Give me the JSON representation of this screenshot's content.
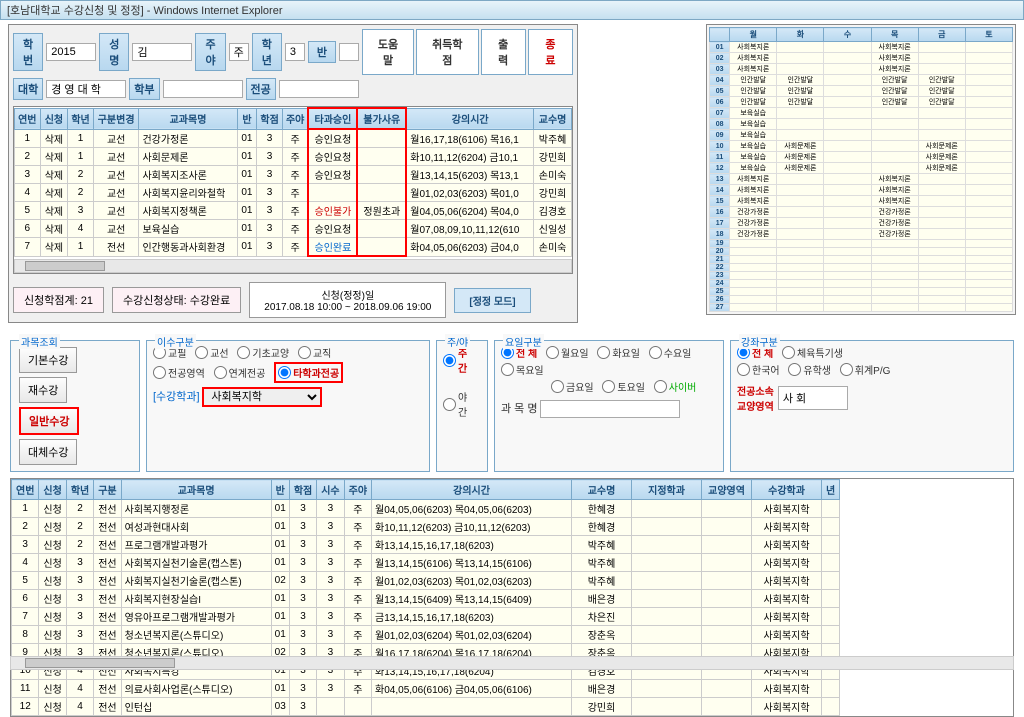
{
  "window_title": "[호남대학교 수강신청 및 정정] - Windows Internet Explorer",
  "form": {
    "hakbun_label": "학번",
    "hakbun": "2015",
    "name_label": "성명",
    "name": "김",
    "day_label": "주야",
    "day": "주",
    "grade_label": "학년",
    "grade": "3",
    "class_label": "반",
    "univ_label": "대학",
    "univ": "경 영 대 학",
    "dept_label": "학부",
    "major_label": "전공"
  },
  "toolbar": {
    "help": "도움말",
    "earned": "취득학점",
    "print": "출 력",
    "exit": "종 료"
  },
  "grid1_headers": {
    "no": "연번",
    "req": "신청",
    "yr": "학년",
    "cls": "구분변경",
    "course": "교과목명",
    "ban": "반",
    "cred": "학점",
    "dn": "주야",
    "appr": "타과승인",
    "reason": "불가사유",
    "time": "강의시간",
    "prof": "교수명"
  },
  "grid1": [
    {
      "no": "1",
      "req": "삭제",
      "yr": "1",
      "cls": "교선",
      "course": "건강가정론",
      "ban": "01",
      "cred": "3",
      "dn": "주",
      "appr": "승인요청",
      "reason": "",
      "time": "월16,17,18(6106) 목16,1",
      "prof": "박주혜"
    },
    {
      "no": "2",
      "req": "삭제",
      "yr": "1",
      "cls": "교선",
      "course": "사회문제론",
      "ban": "01",
      "cred": "3",
      "dn": "주",
      "appr": "승인요청",
      "reason": "",
      "time": "화10,11,12(6204) 금10,1",
      "prof": "강민희"
    },
    {
      "no": "3",
      "req": "삭제",
      "yr": "2",
      "cls": "교선",
      "course": "사회복지조사론",
      "ban": "01",
      "cred": "3",
      "dn": "주",
      "appr": "승인요청",
      "reason": "",
      "time": "월13,14,15(6203) 목13,1",
      "prof": "손미숙"
    },
    {
      "no": "4",
      "req": "삭제",
      "yr": "2",
      "cls": "교선",
      "course": "사회복지윤리와철학",
      "ban": "01",
      "cred": "3",
      "dn": "주",
      "appr": "",
      "reason": "",
      "time": "월01,02,03(6203) 목01,0",
      "prof": "강민희"
    },
    {
      "no": "5",
      "req": "삭제",
      "yr": "3",
      "cls": "교선",
      "course": "사회복지정책론",
      "ban": "01",
      "cred": "3",
      "dn": "주",
      "appr": "승인불가",
      "reason": "정원초과",
      "time": "월04,05,06(6204) 목04,0",
      "prof": "김경호"
    },
    {
      "no": "6",
      "req": "삭제",
      "yr": "4",
      "cls": "교선",
      "course": "보육실습",
      "ban": "01",
      "cred": "3",
      "dn": "주",
      "appr": "승인요청",
      "reason": "",
      "time": "월07,08,09,10,11,12(610",
      "prof": "신일성"
    },
    {
      "no": "7",
      "req": "삭제",
      "yr": "1",
      "cls": "전선",
      "course": "인간행동과사회환경",
      "ban": "01",
      "cred": "3",
      "dn": "주",
      "appr": "승인완료",
      "reason": "",
      "time": "화04,05,06(6203) 금04,0",
      "prof": "손미숙"
    }
  ],
  "status": {
    "credits": "신청학점계:  21",
    "state": "수강신청상태:  수강완료",
    "period_title": "신청(정정)일",
    "period": "2017.08.18 10:00 ~ 2018.09.06 19:00",
    "mode": "[정정 모드]"
  },
  "sched_days": {
    "mon": "월",
    "tue": "화",
    "wed": "수",
    "thu": "목",
    "fri": "금",
    "sat": "토"
  },
  "sched_rows": [
    {
      "no": "01",
      "mon": "사회복지론",
      "thu": "사회복지론"
    },
    {
      "no": "02",
      "mon": "사회복지론",
      "thu": "사회복지론"
    },
    {
      "no": "03",
      "mon": "사회복지론",
      "thu": "사회복지론"
    },
    {
      "no": "04",
      "mon": "인간발달",
      "tue": "인간발달",
      "thu": "인간발달",
      "fri": "인간발달"
    },
    {
      "no": "05",
      "mon": "인간발달",
      "tue": "인간발달",
      "thu": "인간발달",
      "fri": "인간발달"
    },
    {
      "no": "06",
      "mon": "인간발달",
      "tue": "인간발달",
      "thu": "인간발달",
      "fri": "인간발달"
    },
    {
      "no": "07",
      "mon": "보육실습"
    },
    {
      "no": "08",
      "mon": "보육실습"
    },
    {
      "no": "09",
      "mon": "보육실습"
    },
    {
      "no": "10",
      "mon": "보육실습",
      "tue": "사회문제론",
      "fri": "사회문제론"
    },
    {
      "no": "11",
      "mon": "보육실습",
      "tue": "사회문제론",
      "fri": "사회문제론"
    },
    {
      "no": "12",
      "mon": "보육실습",
      "tue": "사회문제론",
      "fri": "사회문제론"
    },
    {
      "no": "13",
      "mon": "사회복지론",
      "thu": "사회복지론"
    },
    {
      "no": "14",
      "mon": "사회복지론",
      "thu": "사회복지론"
    },
    {
      "no": "15",
      "mon": "사회복지론",
      "thu": "사회복지론"
    },
    {
      "no": "16",
      "mon": "건강가정론",
      "thu": "건강가정론"
    },
    {
      "no": "17",
      "mon": "건강가정론",
      "thu": "건강가정론"
    },
    {
      "no": "18",
      "mon": "건강가정론",
      "thu": "건강가정론"
    },
    {
      "no": "19"
    },
    {
      "no": "20"
    },
    {
      "no": "21"
    },
    {
      "no": "22"
    },
    {
      "no": "23"
    },
    {
      "no": "24"
    },
    {
      "no": "25"
    },
    {
      "no": "26"
    },
    {
      "no": "27"
    }
  ],
  "filters": {
    "lookup_title": "과목조회",
    "tab_basic": "기본수강",
    "tab_retake": "재수강",
    "tab_general": "일반수강",
    "tab_subst": "대체수강",
    "compl_title": "이수구분",
    "c_gyopil": "교필",
    "c_gyoseon": "교선",
    "c_gicho": "기초교양",
    "c_gyojik": "교직",
    "c_area": "전공영역",
    "c_link": "연계전공",
    "c_other": "타학과전공",
    "dayn_title": "주/야",
    "dn_day": "주간",
    "dn_night": "야간",
    "dow_title": "요일구분",
    "dw_all": "전 체",
    "dw_mon": "월요일",
    "dw_tue": "화요일",
    "dw_wed": "수요일",
    "dw_thu": "목요일",
    "dw_fri": "금요일",
    "dw_sat": "토요일",
    "dw_cyber": "사이버",
    "lect_title": "강좌구분",
    "lc_all": "전 체",
    "lc_pe": "체육특기생",
    "lc_kr": "한국어",
    "lc_intl": "유학생",
    "lc_pg": "휘계P/G",
    "sel_dept": "[수강학과]",
    "dept_val": "사회복지학",
    "subj_label": "과 목 명",
    "affil1": "전공소속",
    "affil2": "교양영역",
    "affil_val": "사 회"
  },
  "grid2_headers": {
    "no": "연번",
    "req": "신청",
    "yr": "학년",
    "cls": "구분",
    "course": "교과목명",
    "ban": "반",
    "cred": "학점",
    "hrs": "시수",
    "dn": "주야",
    "time": "강의시간",
    "prof": "교수명",
    "dept": "지정학과",
    "area": "교양영역",
    "host": "수강학과",
    "yrh": "년"
  },
  "grid2": [
    {
      "no": "1",
      "req": "신청",
      "yr": "2",
      "cls": "전선",
      "course": "사회복지행정론",
      "ban": "01",
      "cred": "3",
      "hrs": "3",
      "dn": "주",
      "time": "월04,05,06(6203) 목04,05,06(6203)",
      "prof": "한혜경",
      "host": "사회복지학"
    },
    {
      "no": "2",
      "req": "신청",
      "yr": "2",
      "cls": "전선",
      "course": "여성과현대사회",
      "ban": "01",
      "cred": "3",
      "hrs": "3",
      "dn": "주",
      "time": "화10,11,12(6203) 금10,11,12(6203)",
      "prof": "한혜경",
      "host": "사회복지학"
    },
    {
      "no": "3",
      "req": "신청",
      "yr": "2",
      "cls": "전선",
      "course": "프로그램개발과평가",
      "ban": "01",
      "cred": "3",
      "hrs": "3",
      "dn": "주",
      "time": "화13,14,15,16,17,18(6203)",
      "prof": "박주혜",
      "host": "사회복지학"
    },
    {
      "no": "4",
      "req": "신청",
      "yr": "3",
      "cls": "전선",
      "course": "사회복지실천기술론(캡스톤)",
      "ban": "01",
      "cred": "3",
      "hrs": "3",
      "dn": "주",
      "time": "월13,14,15(6106) 목13,14,15(6106)",
      "prof": "박주혜",
      "host": "사회복지학"
    },
    {
      "no": "5",
      "req": "신청",
      "yr": "3",
      "cls": "전선",
      "course": "사회복지실천기술론(캡스톤)",
      "ban": "02",
      "cred": "3",
      "hrs": "3",
      "dn": "주",
      "time": "월01,02,03(6203) 목01,02,03(6203)",
      "prof": "박주혜",
      "host": "사회복지학"
    },
    {
      "no": "6",
      "req": "신청",
      "yr": "3",
      "cls": "전선",
      "course": "사회복지현장실습I",
      "ban": "01",
      "cred": "3",
      "hrs": "3",
      "dn": "주",
      "time": "월13,14,15(6409) 목13,14,15(6409)",
      "prof": "배은경",
      "host": "사회복지학"
    },
    {
      "no": "7",
      "req": "신청",
      "yr": "3",
      "cls": "전선",
      "course": "영유아프로그램개발과평가",
      "ban": "01",
      "cred": "3",
      "hrs": "3",
      "dn": "주",
      "time": "금13,14,15,16,17,18(6203)",
      "prof": "차은진",
      "host": "사회복지학"
    },
    {
      "no": "8",
      "req": "신청",
      "yr": "3",
      "cls": "전선",
      "course": "청소년복지론(스튜디오)",
      "ban": "01",
      "cred": "3",
      "hrs": "3",
      "dn": "주",
      "time": "월01,02,03(6204) 목01,02,03(6204)",
      "prof": "장춘옥",
      "host": "사회복지학"
    },
    {
      "no": "9",
      "req": "신청",
      "yr": "3",
      "cls": "전선",
      "course": "청소년복지론(스튜디오)",
      "ban": "02",
      "cred": "3",
      "hrs": "3",
      "dn": "주",
      "time": "월16,17,18(6204) 목16,17,18(6204)",
      "prof": "장춘옥",
      "host": "사회복지학"
    },
    {
      "no": "10",
      "req": "신청",
      "yr": "4",
      "cls": "전선",
      "course": "사회복지특강",
      "ban": "01",
      "cred": "3",
      "hrs": "3",
      "dn": "주",
      "time": "화13,14,15,16,17,18(6204)",
      "prof": "김경호",
      "host": "사회복지학"
    },
    {
      "no": "11",
      "req": "신청",
      "yr": "4",
      "cls": "전선",
      "course": "의료사회사업론(스튜디오)",
      "ban": "01",
      "cred": "3",
      "hrs": "3",
      "dn": "주",
      "time": "화04,05,06(6106) 금04,05,06(6106)",
      "prof": "배은경",
      "host": "사회복지학"
    },
    {
      "no": "12",
      "req": "신청",
      "yr": "4",
      "cls": "전선",
      "course": "인턴십",
      "ban": "03",
      "cred": "3",
      "hrs": "",
      "dn": "",
      "time": "",
      "prof": "강민희",
      "host": "사회복지학"
    }
  ]
}
